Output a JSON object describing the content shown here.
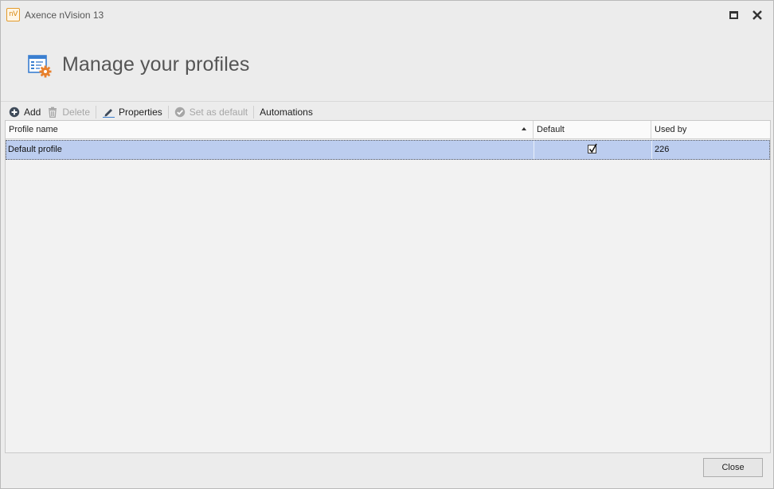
{
  "window": {
    "app_logo_text": "nV",
    "title": "Axence nVision 13"
  },
  "header": {
    "title": "Manage your profiles",
    "icon": "profile-settings-icon"
  },
  "toolbar": {
    "add_label": "Add",
    "delete_label": "Delete",
    "properties_label": "Properties",
    "set_default_label": "Set as default",
    "automations_label": "Automations"
  },
  "grid": {
    "columns": [
      "Profile name",
      "Default",
      "Used by"
    ],
    "sorted_column": "Profile name",
    "sort_direction": "ascending",
    "rows": [
      {
        "name": "Default profile",
        "is_default": true,
        "used_by": "226",
        "selected": true
      }
    ]
  },
  "footer": {
    "close_label": "Close"
  },
  "colors": {
    "selection": "#bccdef",
    "accent_orange": "#e8802c",
    "accent_blue": "#3a7fd0"
  }
}
